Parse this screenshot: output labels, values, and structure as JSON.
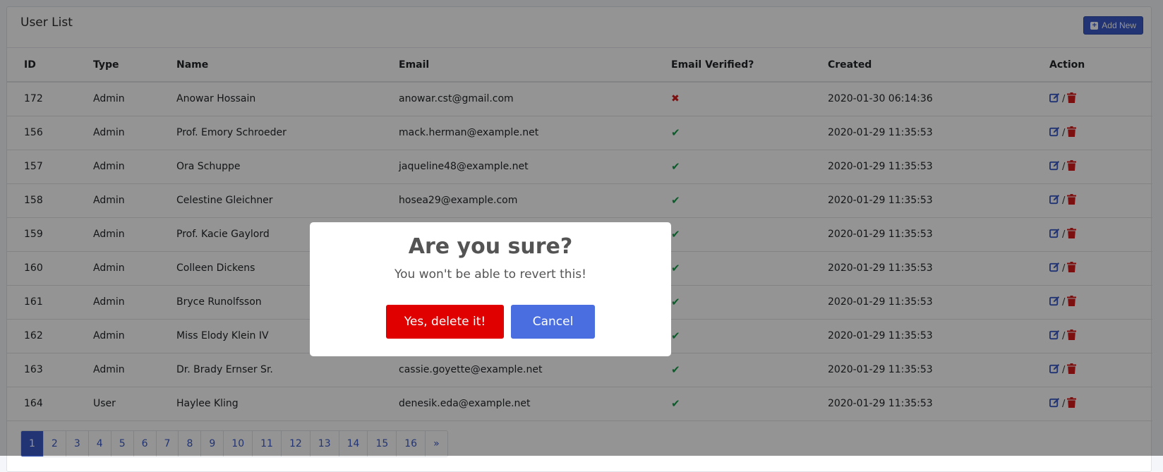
{
  "card": {
    "title": "User List",
    "add_button_label": "Add New"
  },
  "table": {
    "headers": [
      "ID",
      "Type",
      "Name",
      "Email",
      "Email Verified?",
      "Created",
      "Action"
    ],
    "rows": [
      {
        "id": "172",
        "type": "Admin",
        "name": "Anowar Hossain",
        "email": "anowar.cst@gmail.com",
        "verified": false,
        "created": "2020-01-30 06:14:36"
      },
      {
        "id": "156",
        "type": "Admin",
        "name": "Prof. Emory Schroeder",
        "email": "mack.herman@example.net",
        "verified": true,
        "created": "2020-01-29 11:35:53"
      },
      {
        "id": "157",
        "type": "Admin",
        "name": "Ora Schuppe",
        "email": "jaqueline48@example.net",
        "verified": true,
        "created": "2020-01-29 11:35:53"
      },
      {
        "id": "158",
        "type": "Admin",
        "name": "Celestine Gleichner",
        "email": "hosea29@example.com",
        "verified": true,
        "created": "2020-01-29 11:35:53"
      },
      {
        "id": "159",
        "type": "Admin",
        "name": "Prof. Kacie Gaylord",
        "email": "",
        "verified": true,
        "created": "2020-01-29 11:35:53"
      },
      {
        "id": "160",
        "type": "Admin",
        "name": "Colleen Dickens",
        "email": "",
        "verified": true,
        "created": "2020-01-29 11:35:53"
      },
      {
        "id": "161",
        "type": "Admin",
        "name": "Bryce Runolfsson",
        "email": "",
        "verified": true,
        "created": "2020-01-29 11:35:53"
      },
      {
        "id": "162",
        "type": "Admin",
        "name": "Miss Elody Klein IV",
        "email": "",
        "verified": true,
        "created": "2020-01-29 11:35:53"
      },
      {
        "id": "163",
        "type": "Admin",
        "name": "Dr. Brady Ernser Sr.",
        "email": "cassie.goyette@example.net",
        "verified": true,
        "created": "2020-01-29 11:35:53"
      },
      {
        "id": "164",
        "type": "User",
        "name": "Haylee Kling",
        "email": "denesik.eda@example.net",
        "verified": true,
        "created": "2020-01-29 11:35:53"
      }
    ],
    "action_separator": "/"
  },
  "pagination": {
    "pages": [
      "1",
      "2",
      "3",
      "4",
      "5",
      "6",
      "7",
      "8",
      "9",
      "10",
      "11",
      "12",
      "13",
      "14",
      "15",
      "16"
    ],
    "active": "1",
    "next_label": "»"
  },
  "modal": {
    "title": "Are you sure?",
    "text": "You won't be able to revert this!",
    "confirm_label": "Yes, delete it!",
    "cancel_label": "Cancel"
  },
  "colors": {
    "primary": "#3b5bc7",
    "danger": "#e00000",
    "success": "#1a9b4b",
    "cancel": "#4a6ee0"
  },
  "icons": {
    "verified_true": "check-icon",
    "verified_false": "x-icon",
    "edit": "edit-icon",
    "delete": "trash-icon",
    "add": "plus-square-icon"
  }
}
